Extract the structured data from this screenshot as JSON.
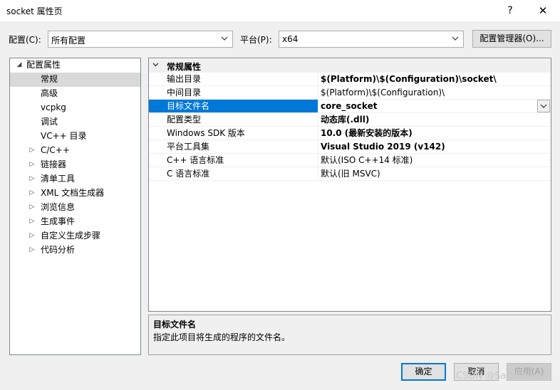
{
  "window": {
    "title": "socket 属性页",
    "help_label": "?",
    "close_label": "✕"
  },
  "toolbar": {
    "config_label": "配置(C):",
    "config_value": "所有配置",
    "platform_label": "平台(P):",
    "platform_value": "x64",
    "config_manager_label": "配置管理器(O)..."
  },
  "tree": {
    "root": "配置属性",
    "items": [
      {
        "label": "常规",
        "selected": true,
        "expandable": false
      },
      {
        "label": "高级",
        "expandable": false
      },
      {
        "label": "vcpkg",
        "expandable": false
      },
      {
        "label": "调试",
        "expandable": false
      },
      {
        "label": "VC++ 目录",
        "expandable": false
      },
      {
        "label": "C/C++",
        "expandable": true
      },
      {
        "label": "链接器",
        "expandable": true
      },
      {
        "label": "清单工具",
        "expandable": true
      },
      {
        "label": "XML 文档生成器",
        "expandable": true
      },
      {
        "label": "浏览信息",
        "expandable": true
      },
      {
        "label": "生成事件",
        "expandable": true
      },
      {
        "label": "自定义生成步骤",
        "expandable": true
      },
      {
        "label": "代码分析",
        "expandable": true
      }
    ]
  },
  "grid": {
    "category": "常规属性",
    "rows": [
      {
        "name": "输出目录",
        "value": "$(Platform)\\$(Configuration)\\socket\\",
        "bold": true
      },
      {
        "name": "中间目录",
        "value": "$(Platform)\\$(Configuration)\\",
        "bold": false
      },
      {
        "name": "目标文件名",
        "value": "core_socket",
        "bold": true,
        "selected": true
      },
      {
        "name": "配置类型",
        "value": "动态库(.dll)",
        "bold": true
      },
      {
        "name": "Windows SDK 版本",
        "value": "10.0 (最新安装的版本)",
        "bold": true
      },
      {
        "name": "平台工具集",
        "value": "Visual Studio 2019 (v142)",
        "bold": true
      },
      {
        "name": "C++ 语言标准",
        "value": "默认(ISO C++14 标准)",
        "bold": false
      },
      {
        "name": "C 语言标准",
        "value": "默认(旧 MSVC)",
        "bold": false
      }
    ]
  },
  "description": {
    "title": "目标文件名",
    "text": "指定此项目将生成的程序的文件名。"
  },
  "footer": {
    "ok_label": "确定",
    "cancel_label": "取消",
    "apply_label": "应用(A)"
  },
  "watermark": "CSDN @SailorXing",
  "colors": {
    "accent": "#0078d7",
    "tree_selected": "#d9d9d9",
    "dialog_bg": "#f0f0f0"
  }
}
